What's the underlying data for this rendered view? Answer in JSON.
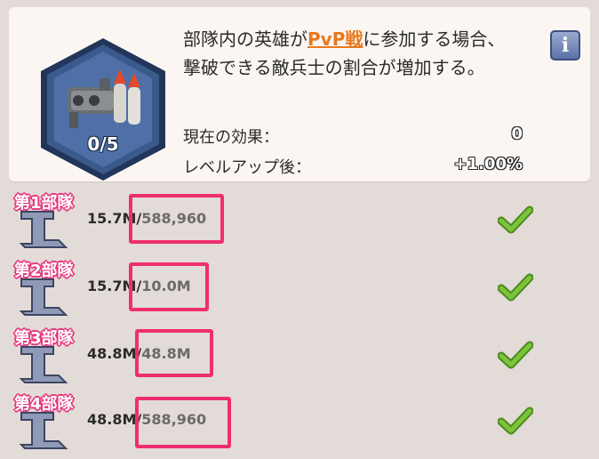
{
  "panel": {
    "badge_count": "0/5",
    "description_line1_pre": "部隊内の英雄が",
    "description_highlight": "PvP戦",
    "description_line1_post": "に参加する場合、",
    "description_line2": "撃破できる敵兵士の割合が増加する。",
    "info_button_label": "i",
    "stats": [
      {
        "label": "現在の効果：",
        "value": "0"
      },
      {
        "label": "レベルアップ後：",
        "value": "+1.00%"
      }
    ]
  },
  "teams": [
    {
      "label": "第1部隊",
      "current": "15.7M",
      "separator": "/",
      "target": "588,960",
      "status_icon": "check-icon"
    },
    {
      "label": "第2部隊",
      "current": "15.7M",
      "separator": "/",
      "target": "10.0M",
      "status_icon": "check-icon"
    },
    {
      "label": "第3部隊",
      "current": "48.8M",
      "separator": "/",
      "target": "48.8M",
      "status_icon": "check-icon"
    },
    {
      "label": "第4部隊",
      "current": "48.8M",
      "separator": "/",
      "target": "588,960",
      "status_icon": "check-icon"
    }
  ],
  "colors": {
    "highlight_text": "#e8791e",
    "annotation_box": "#ef2e6f",
    "check_green": "#7cc43a",
    "badge_blue": "#3b5a8c"
  }
}
